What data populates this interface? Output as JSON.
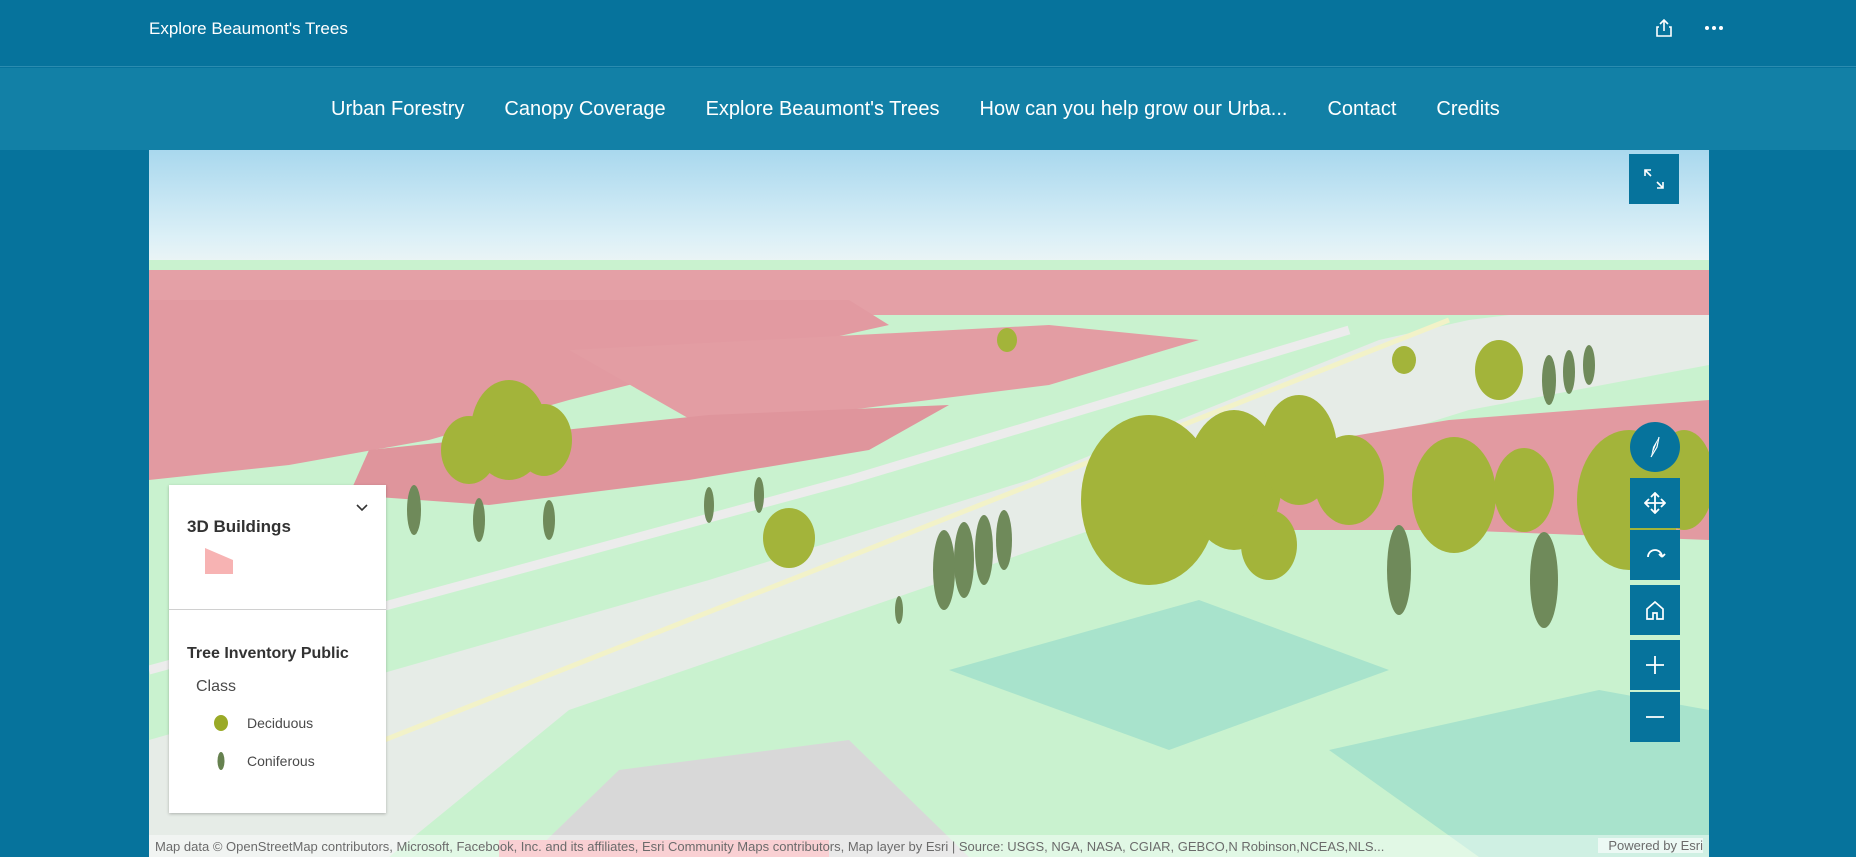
{
  "header": {
    "title": "Explore Beaumont's Trees",
    "actions": [
      {
        "icon": "share-icon"
      },
      {
        "icon": "more-options-icon"
      }
    ]
  },
  "nav": {
    "items": [
      {
        "label": "Urban Forestry"
      },
      {
        "label": "Canopy Coverage"
      },
      {
        "label": "Explore Beaumont's Trees"
      },
      {
        "label": "How can you help grow our Urba..."
      },
      {
        "label": "Contact"
      },
      {
        "label": "Credits"
      }
    ]
  },
  "map": {
    "controls": {
      "fullscreen_icon": "expand-icon",
      "compass_icon": "compass-icon",
      "pan_icon": "pan-icon",
      "rotate_icon": "rotate-icon",
      "home_icon": "home-icon",
      "zoom_in_icon": "plus-icon",
      "zoom_out_icon": "minus-icon"
    },
    "legend": {
      "layers": [
        {
          "title": "3D Buildings",
          "swatch_color": "#f7b3b3"
        },
        {
          "title": "Tree Inventory Public",
          "field": "Class",
          "entries": [
            {
              "label": "Deciduous",
              "color": "#9aaa27"
            },
            {
              "label": "Coniferous",
              "color": "#66814f"
            }
          ]
        }
      ]
    },
    "attribution": "Map data © OpenStreetMap contributors, Microsoft, Facebook, Inc. and its affiliates, Esri Community Maps contributors, Map layer by Esri | Source: USGS, NGA, NASA, CGIAR, GEBCO,N Robinson,NCEAS,NLS...",
    "powered_by": "Powered by Esri"
  },
  "colors": {
    "brand": "#06739c",
    "nav_bg": "#1280a6",
    "buildings": "#e89aa2",
    "ground": "#c9f2cf",
    "deciduous": "#a3b43a",
    "coniferous": "#6f8a5a"
  }
}
